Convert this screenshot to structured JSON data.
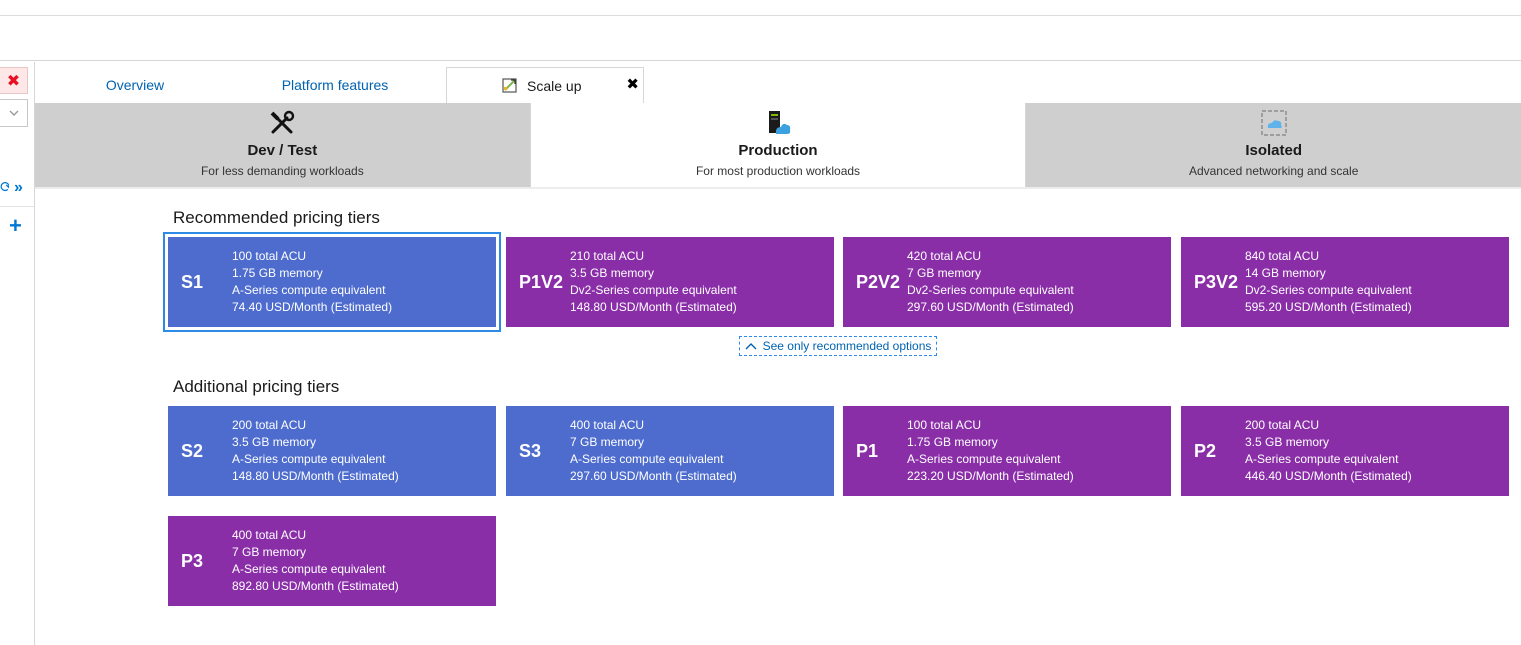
{
  "tabs": [
    {
      "label": "Overview"
    },
    {
      "label": "Platform features"
    },
    {
      "label": "Scale up"
    }
  ],
  "categories": [
    {
      "title": "Dev / Test",
      "subtitle": "For less demanding workloads",
      "icon": "tools-icon"
    },
    {
      "title": "Production",
      "subtitle": "For most production workloads",
      "icon": "server-cloud-icon"
    },
    {
      "title": "Isolated",
      "subtitle": "Advanced networking and scale",
      "icon": "isolated-cloud-icon"
    }
  ],
  "sections": {
    "recommended": "Recommended pricing tiers",
    "additional": "Additional pricing tiers"
  },
  "see_only_label": "See only recommended options",
  "accent_colors": {
    "blue": "#4d6ccd",
    "purple": "#8a2ea8",
    "selection": "#2d8be6"
  },
  "recommended_tiers": [
    {
      "tier": "S1",
      "acu": "100 total ACU",
      "memory": "1.75 GB memory",
      "compute": "A-Series compute equivalent",
      "price": "74.40 USD/Month (Estimated)",
      "color": "blue",
      "selected": true
    },
    {
      "tier": "P1V2",
      "acu": "210 total ACU",
      "memory": "3.5 GB memory",
      "compute": "Dv2-Series compute equivalent",
      "price": "148.80 USD/Month (Estimated)",
      "color": "purple"
    },
    {
      "tier": "P2V2",
      "acu": "420 total ACU",
      "memory": "7 GB memory",
      "compute": "Dv2-Series compute equivalent",
      "price": "297.60 USD/Month (Estimated)",
      "color": "purple"
    },
    {
      "tier": "P3V2",
      "acu": "840 total ACU",
      "memory": "14 GB memory",
      "compute": "Dv2-Series compute equivalent",
      "price": "595.20 USD/Month (Estimated)",
      "color": "purple"
    }
  ],
  "additional_tiers": [
    {
      "tier": "S2",
      "acu": "200 total ACU",
      "memory": "3.5 GB memory",
      "compute": "A-Series compute equivalent",
      "price": "148.80 USD/Month (Estimated)",
      "color": "blue"
    },
    {
      "tier": "S3",
      "acu": "400 total ACU",
      "memory": "7 GB memory",
      "compute": "A-Series compute equivalent",
      "price": "297.60 USD/Month (Estimated)",
      "color": "blue"
    },
    {
      "tier": "P1",
      "acu": "100 total ACU",
      "memory": "1.75 GB memory",
      "compute": "A-Series compute equivalent",
      "price": "223.20 USD/Month (Estimated)",
      "color": "purple"
    },
    {
      "tier": "P2",
      "acu": "200 total ACU",
      "memory": "3.5 GB memory",
      "compute": "A-Series compute equivalent",
      "price": "446.40 USD/Month (Estimated)",
      "color": "purple"
    },
    {
      "tier": "P3",
      "acu": "400 total ACU",
      "memory": "7 GB memory",
      "compute": "A-Series compute equivalent",
      "price": "892.80 USD/Month (Estimated)",
      "color": "purple"
    }
  ]
}
